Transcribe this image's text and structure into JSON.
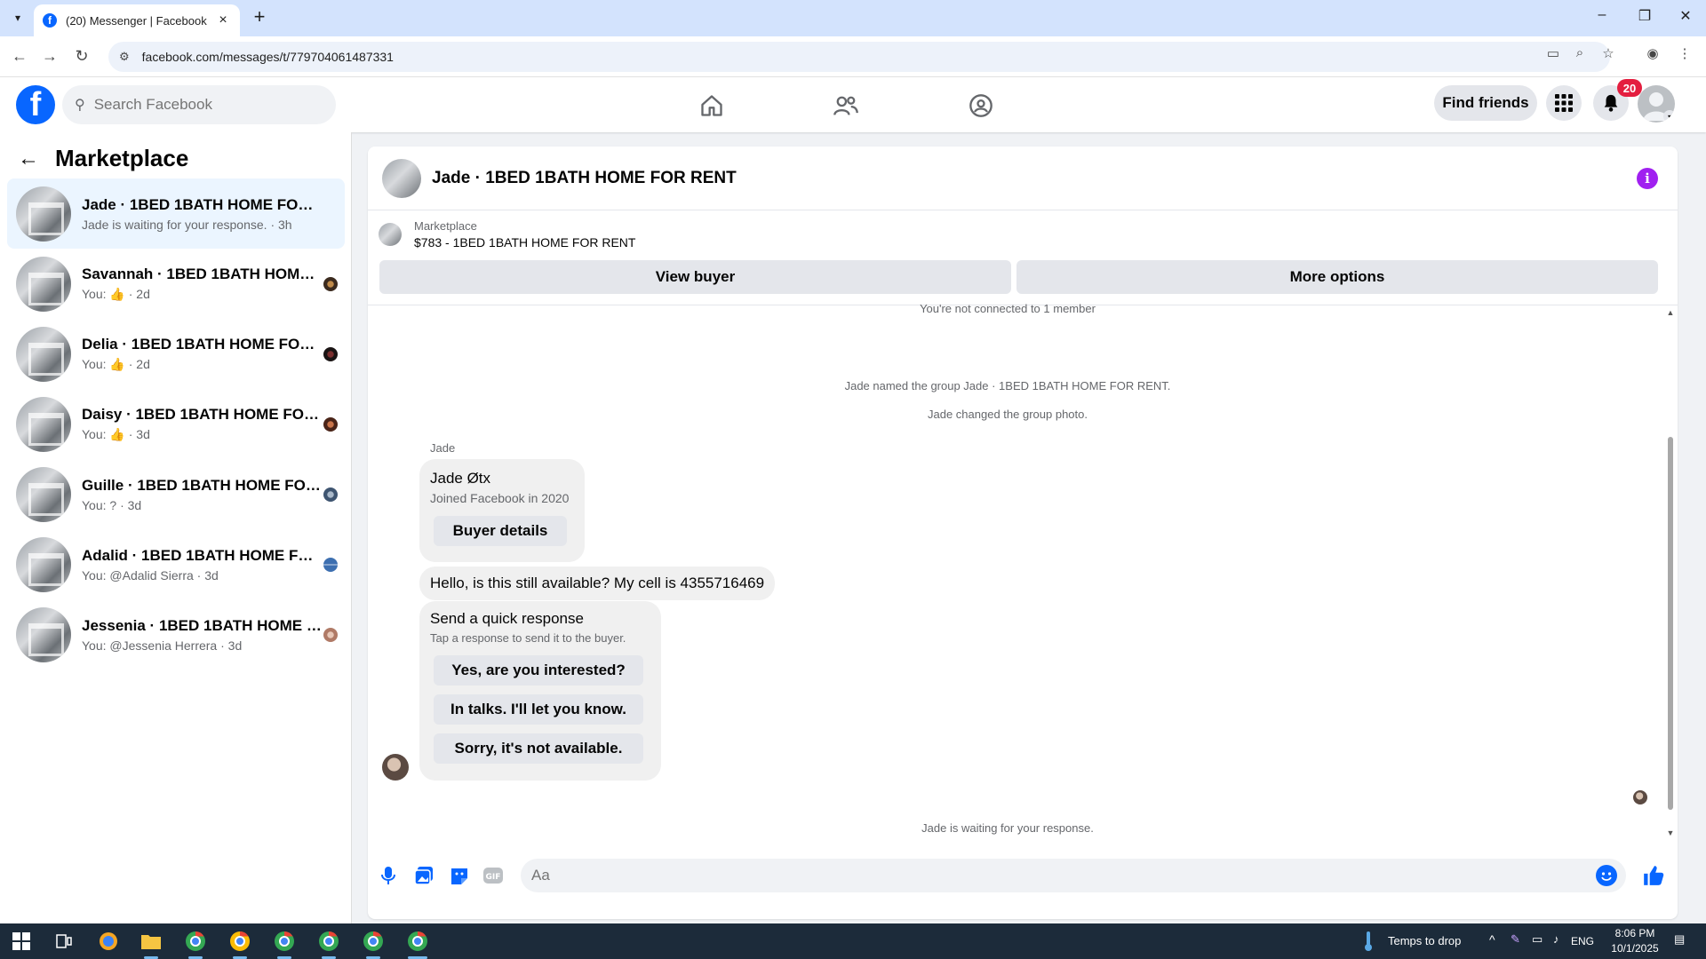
{
  "browser": {
    "tab_title": "(20) Messenger | Facebook",
    "url": "facebook.com/messages/t/779704061487331"
  },
  "fb_header": {
    "search_placeholder": "Search Facebook",
    "find_friends": "Find friends",
    "notification_count": "20"
  },
  "sidebar": {
    "title": "Marketplace",
    "conversations": [
      {
        "name": "Jade · 1BED 1BATH HOME FOR RENT",
        "preview": "Jade is waiting for your response. · 3h",
        "active": true
      },
      {
        "name": "Savannah · 1BED 1BATH HOME F...",
        "preview_prefix": "You:",
        "preview_suffix": "· 2d"
      },
      {
        "name": "Delia · 1BED 1BATH HOME FOR ...",
        "preview_prefix": "You:",
        "preview_suffix": "· 2d"
      },
      {
        "name": "Daisy · 1BED 1BATH HOME FOR ...",
        "preview_prefix": "You:",
        "preview_suffix": "· 3d"
      },
      {
        "name": "Guille · 1BED 1BATH HOME FOR ...",
        "preview": "You: ? · 3d"
      },
      {
        "name": "Adalid · 1BED 1BATH HOME FOR...",
        "preview": "You: @Adalid Sierra · 3d"
      },
      {
        "name": "Jessenia · 1BED 1BATH HOME FO...",
        "preview": "You: @Jessenia Herrera · 3d"
      }
    ]
  },
  "chat": {
    "title": "Jade · 1BED 1BATH HOME FOR RENT",
    "listing_label": "Marketplace",
    "listing_title": "$783 - 1BED 1BATH HOME FOR RENT",
    "view_buyer": "View buyer",
    "more_options": "More options",
    "not_connected": "You're not connected to 1 member",
    "sys_named": "Jade named the group Jade · 1BED 1BATH HOME FOR RENT.",
    "sys_photo": "Jade changed the group photo.",
    "sender": "Jade",
    "card_name": "Jade Øtx",
    "card_joined": "Joined Facebook in 2020",
    "buyer_details": "Buyer details",
    "message": "Hello, is this still available? My cell is 4355716469",
    "quick_title": "Send a quick response",
    "quick_sub": "Tap a response to send it to the buyer.",
    "quick_responses": [
      "Yes, are you interested?",
      "In talks. I'll let you know.",
      "Sorry, it's not available."
    ],
    "waiting": "Jade is waiting for your response.",
    "input_placeholder": "Aa"
  },
  "taskbar": {
    "weather": "Temps to drop",
    "lang": "ENG",
    "time": "8:06 PM",
    "date": "10/1/2025"
  },
  "colors": {
    "fb_blue": "#0866ff",
    "info_purple": "#a020f0",
    "badge_red": "#e41e3f"
  }
}
